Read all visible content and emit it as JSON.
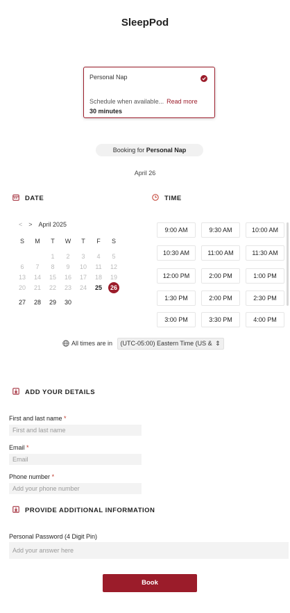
{
  "app": {
    "title": "SleepPod"
  },
  "service": {
    "name": "Personal Nap",
    "description": "Schedule when available...",
    "read_more": "Read more",
    "duration": "30 minutes"
  },
  "booking": {
    "prefix": "Booking for",
    "service": "Personal Nap"
  },
  "selected_date": "April 26",
  "date_section": {
    "label": "DATE"
  },
  "time_section": {
    "label": "TIME"
  },
  "calendar": {
    "month": "April 2025",
    "prev": "<",
    "next": ">",
    "weekdays": [
      "S",
      "M",
      "T",
      "W",
      "T",
      "F",
      "S"
    ],
    "weeks": [
      [
        "",
        "",
        "1",
        "2",
        "3",
        "4",
        "5"
      ],
      [
        "6",
        "7",
        "8",
        "9",
        "10",
        "11",
        "12"
      ],
      [
        "13",
        "14",
        "15",
        "16",
        "17",
        "18",
        "19"
      ],
      [
        "20",
        "21",
        "22",
        "23",
        "24",
        "25",
        "26"
      ],
      [
        "27",
        "28",
        "29",
        "30",
        "",
        "",
        ""
      ]
    ],
    "selected_day": "26",
    "available_days": [
      "25",
      "26",
      "27",
      "28",
      "29",
      "30"
    ]
  },
  "times": [
    "9:00 AM",
    "9:30 AM",
    "10:00 AM",
    "10:30 AM",
    "11:00 AM",
    "11:30 AM",
    "12:00 PM",
    "2:00 PM",
    "1:00 PM",
    "1:30 PM",
    "2:00 PM",
    "2:30 PM",
    "3:00 PM",
    "3:30 PM",
    "4:00 PM"
  ],
  "timezone": {
    "prefix": "All times are in",
    "value": "(UTC-05:00) Eastern Time (US &"
  },
  "details_section": {
    "label": "ADD YOUR DETAILS"
  },
  "fields": {
    "name": {
      "label": "First and last name",
      "required": "*",
      "placeholder": "First and last name"
    },
    "email": {
      "label": "Email",
      "required": "*",
      "placeholder": "Email"
    },
    "phone": {
      "label": "Phone number",
      "required": "*",
      "placeholder": "Add your phone number"
    }
  },
  "additional_section": {
    "label": "PROVIDE ADDITIONAL INFORMATION"
  },
  "additional_field": {
    "label": "Personal Password (4 Digit Pin)",
    "placeholder": "Add your answer here"
  },
  "book_button": {
    "label": "Book"
  },
  "colors": {
    "accent": "#9b1c2a"
  }
}
